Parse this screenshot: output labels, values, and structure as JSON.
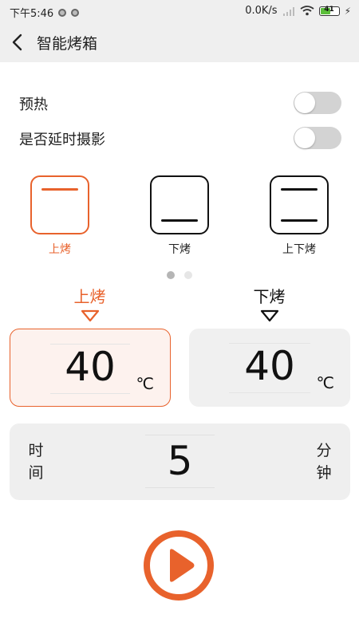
{
  "status_bar": {
    "time": "下午5:46",
    "network_speed": "0.0K/s",
    "battery_level": "41"
  },
  "header": {
    "title": "智能烤箱"
  },
  "settings": [
    {
      "label": "预热",
      "enabled": false
    },
    {
      "label": "是否延时摄影",
      "enabled": false
    }
  ],
  "modes": [
    {
      "label": "上烤",
      "selected": true
    },
    {
      "label": "下烤",
      "selected": false
    },
    {
      "label": "上下烤",
      "selected": false
    }
  ],
  "mode_pager": {
    "total": 2,
    "current": 1
  },
  "temperature": {
    "upper": {
      "label": "上烤",
      "value": "40",
      "unit": "℃"
    },
    "lower": {
      "label": "下烤",
      "value": "40",
      "unit": "℃"
    }
  },
  "time": {
    "label_left": "时间",
    "value": "5",
    "label_right": "分钟"
  },
  "colors": {
    "accent": "#e8622c",
    "panel": "#efefef"
  }
}
